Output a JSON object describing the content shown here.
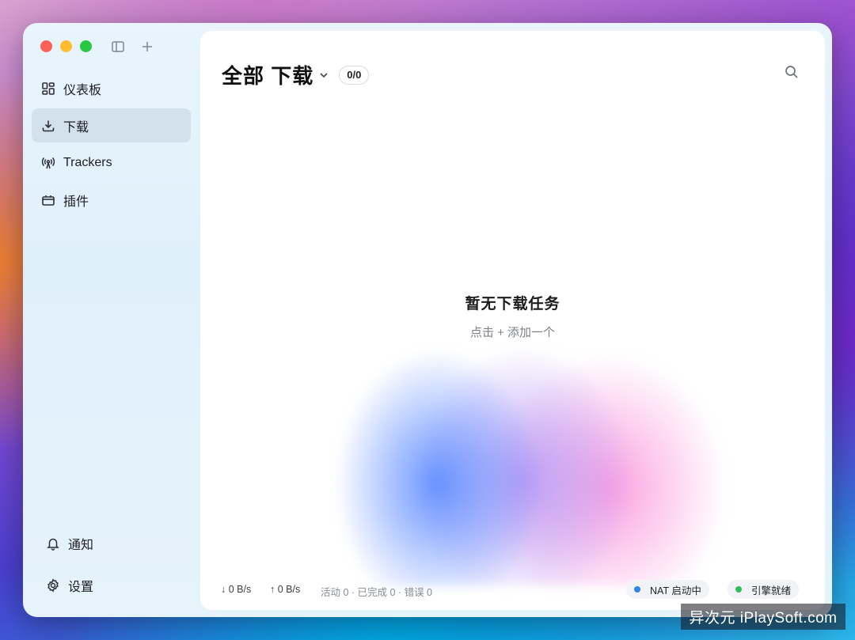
{
  "sidebar": {
    "items": [
      {
        "label": "仪表板",
        "icon": "dashboard-icon"
      },
      {
        "label": "下载",
        "icon": "download-icon",
        "active": true
      },
      {
        "label": "Trackers",
        "icon": "broadcast-icon"
      },
      {
        "label": "插件",
        "icon": "plugin-icon"
      }
    ],
    "bottom": [
      {
        "label": "通知",
        "icon": "bell-icon"
      },
      {
        "label": "设置",
        "icon": "gear-icon"
      }
    ]
  },
  "header": {
    "title": "全部 下载",
    "count": "0/0"
  },
  "empty_state": {
    "title": "暂无下载任务",
    "subtitle": "点击 + 添加一个"
  },
  "statusbar": {
    "download_speed": "↓ 0 B/s",
    "upload_speed": "↑ 0 B/s",
    "summary": "活动 0 · 已完成 0 · 错误 0",
    "nat": "NAT 启动中",
    "engine": "引擎就绪"
  },
  "colors": {
    "nat_dot": "#2f86e8",
    "engine_dot": "#2ebd59",
    "active_nav_bg": "#cddce8"
  },
  "watermark": "异次元 iPlaySoft.com"
}
